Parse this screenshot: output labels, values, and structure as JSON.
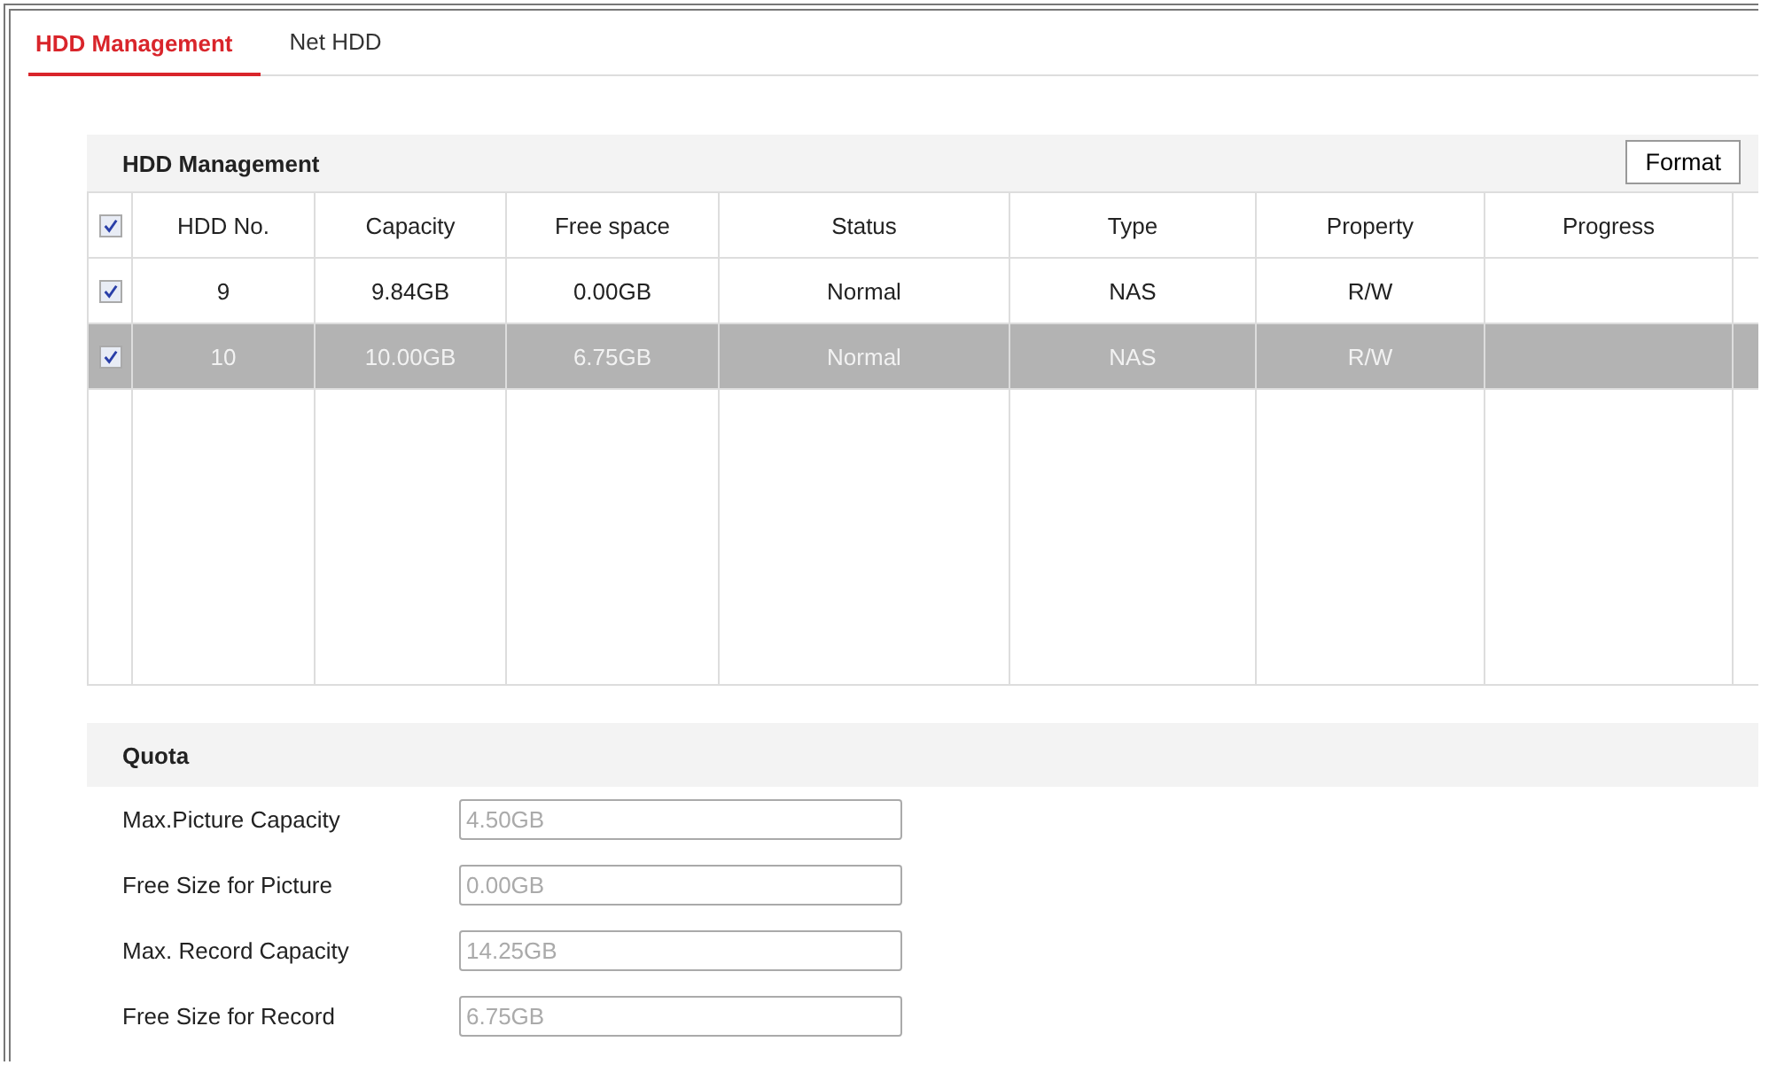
{
  "tabs": [
    {
      "label": "HDD Management",
      "selected": true
    },
    {
      "label": "Net HDD",
      "selected": false
    }
  ],
  "hdd_panel": {
    "title": "HDD Management",
    "format_button": "Format",
    "select_all_checked": true,
    "columns": [
      "HDD No.",
      "Capacity",
      "Free space",
      "Status",
      "Type",
      "Property",
      "Progress"
    ],
    "rows": [
      {
        "checked": true,
        "selected": false,
        "cells": [
          "9",
          "9.84GB",
          "0.00GB",
          "Normal",
          "NAS",
          "R/W",
          ""
        ]
      },
      {
        "checked": true,
        "selected": true,
        "cells": [
          "10",
          "10.00GB",
          "6.75GB",
          "Normal",
          "NAS",
          "R/W",
          ""
        ]
      }
    ]
  },
  "quota": {
    "title": "Quota",
    "fields": [
      {
        "label": "Max.Picture Capacity",
        "value": "4.50GB",
        "disabled": true
      },
      {
        "label": "Free Size for Picture",
        "value": "0.00GB",
        "disabled": true
      },
      {
        "label": "Max. Record Capacity",
        "value": "14.25GB",
        "disabled": true
      },
      {
        "label": "Free Size for Record",
        "value": "6.75GB",
        "disabled": true
      }
    ]
  }
}
